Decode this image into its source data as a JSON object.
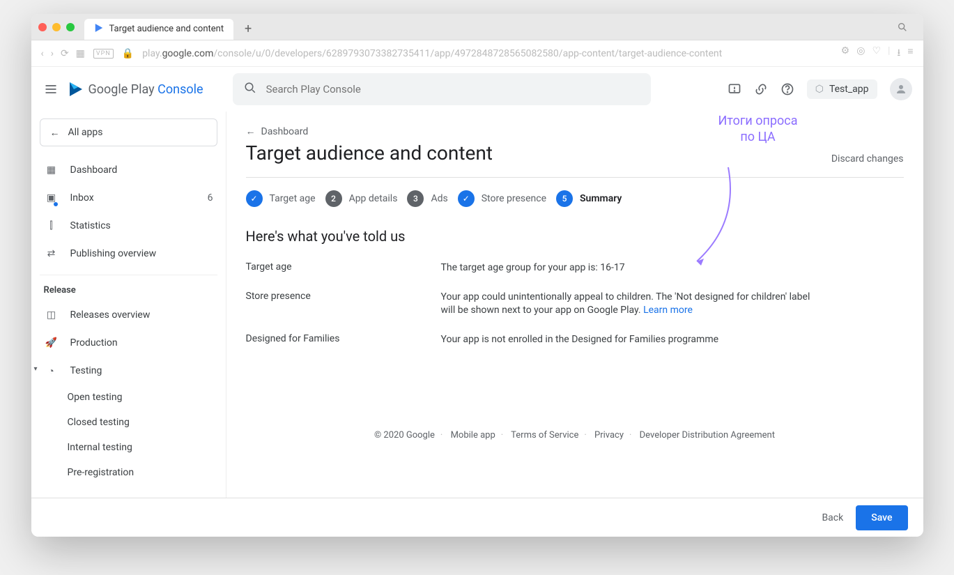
{
  "browser": {
    "tab_title": "Target audience and content",
    "url_prefix": "play.",
    "url_domain": "google.com",
    "url_path": "/console/u/0/developers/6289793073382735411/app/4972848728565082580/app-content/target-audience-content"
  },
  "header": {
    "logo_text_1": "Google Play ",
    "logo_text_2": "Console",
    "search_placeholder": "Search Play Console",
    "app_name": "Test_app"
  },
  "sidebar": {
    "all_apps": "All apps",
    "items": [
      {
        "label": "Dashboard"
      },
      {
        "label": "Inbox",
        "count": "6"
      },
      {
        "label": "Statistics"
      },
      {
        "label": "Publishing overview"
      }
    ],
    "section_release": "Release",
    "release_items": [
      {
        "label": "Releases overview"
      },
      {
        "label": "Production"
      },
      {
        "label": "Testing"
      }
    ],
    "testing_sub": [
      {
        "label": "Open testing"
      },
      {
        "label": "Closed testing"
      },
      {
        "label": "Internal testing"
      },
      {
        "label": "Pre-registration"
      }
    ]
  },
  "main": {
    "breadcrumb": "Dashboard",
    "title": "Target audience and content",
    "discard": "Discard changes",
    "steps": [
      {
        "label": "Target age",
        "state": "done",
        "badge": "✓"
      },
      {
        "label": "App details",
        "state": "pend",
        "badge": "2"
      },
      {
        "label": "Ads",
        "state": "pend",
        "badge": "3"
      },
      {
        "label": "Store presence",
        "state": "done",
        "badge": "✓"
      },
      {
        "label": "Summary",
        "state": "active",
        "badge": "5"
      }
    ],
    "subtitle": "Here's what you've told us",
    "rows": [
      {
        "label": "Target age",
        "value": "The target age group for your app is: 16-17"
      },
      {
        "label": "Store presence",
        "value": "Your app could unintentionally appeal to children. The 'Not designed for children' label will be shown next to your app on Google Play. ",
        "link": "Learn more"
      },
      {
        "label": "Designed for Families",
        "value": "Your app is not enrolled in the Designed for Families programme"
      }
    ],
    "annotation": "Итоги опроса\nпо ЦА"
  },
  "footer": {
    "copyright": "© 2020 Google",
    "links": [
      "Mobile app",
      "Terms of Service",
      "Privacy",
      "Developer Distribution Agreement"
    ]
  },
  "bottombar": {
    "back": "Back",
    "save": "Save"
  }
}
